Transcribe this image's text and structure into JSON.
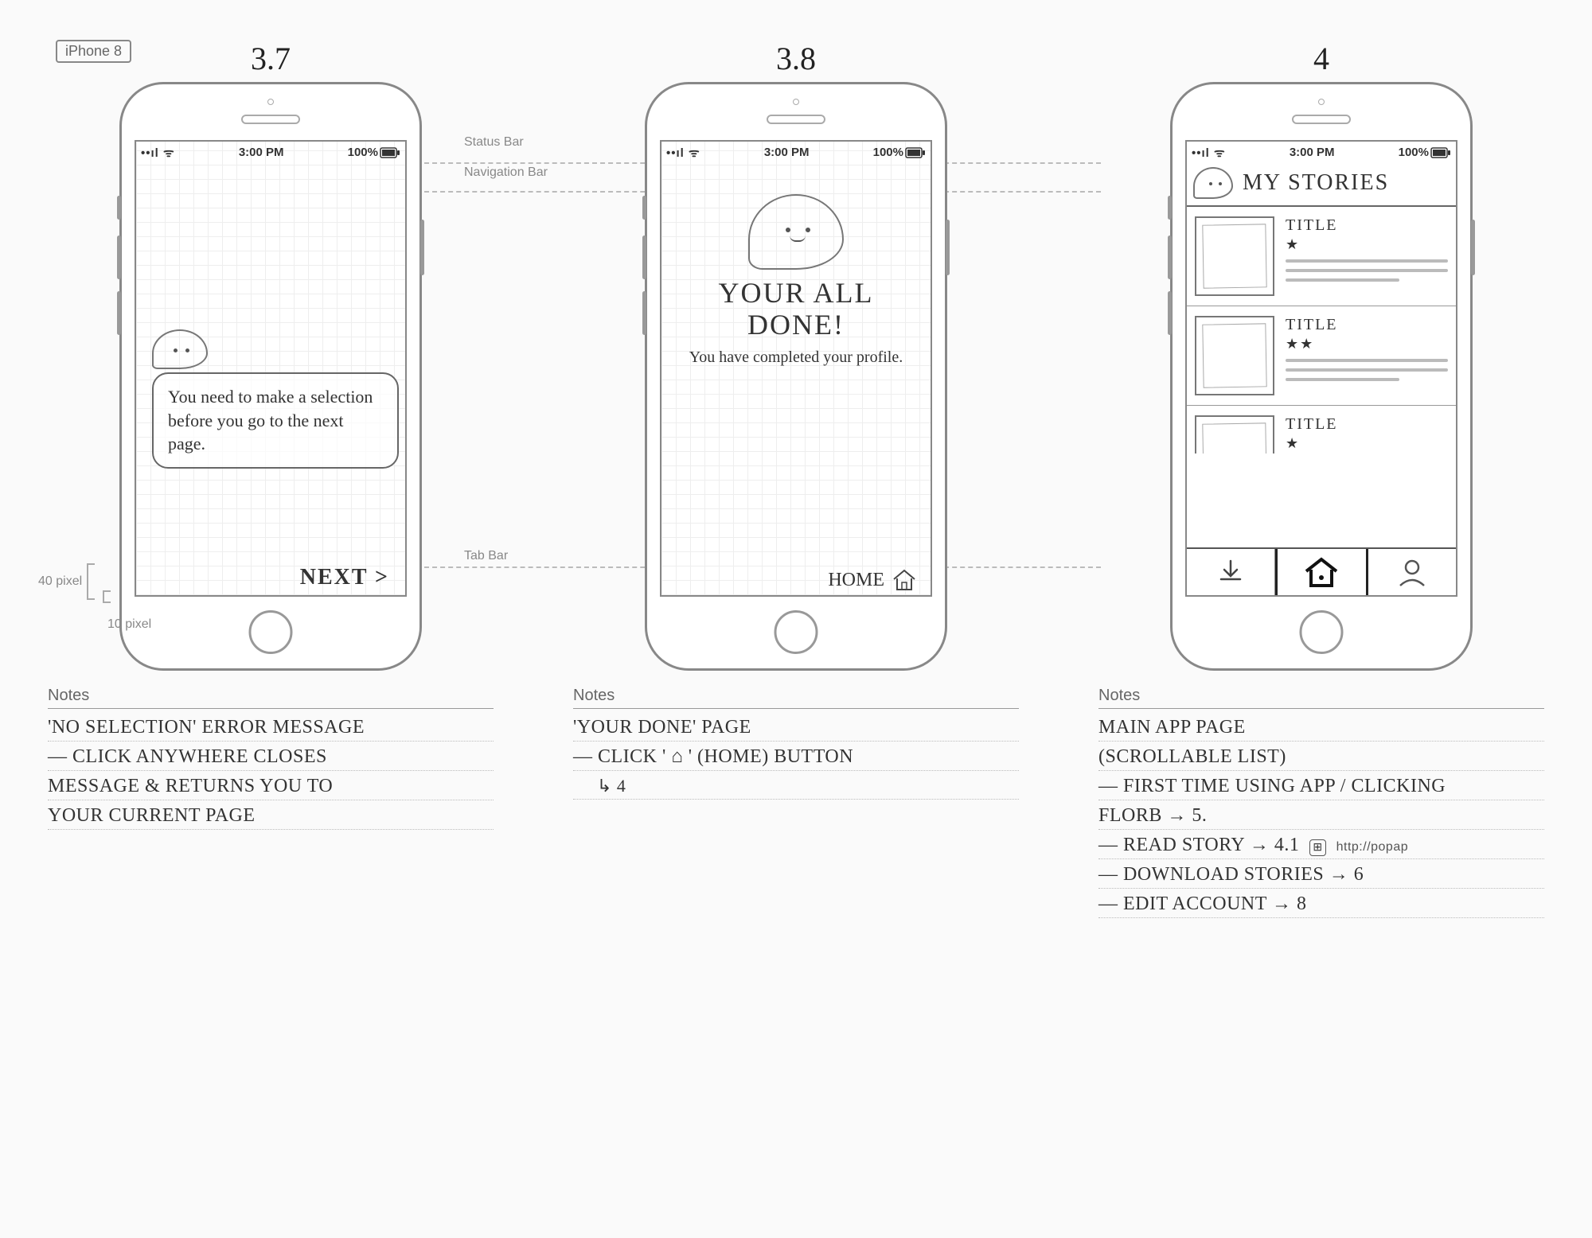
{
  "device_label": "iPhone 8",
  "guide_labels": {
    "status_bar": "Status Bar",
    "nav_bar": "Navigation Bar",
    "tab_bar": "Tab Bar",
    "px40": "40 pixel",
    "px10": "10 pixel"
  },
  "status_bar": {
    "carrier": "••ıl ᯤ",
    "time": "3:00 PM",
    "battery": "100%"
  },
  "screens": [
    {
      "number": "3.7",
      "message": "You need to make a selection before you go to the next page.",
      "next_label": "NEXT >"
    },
    {
      "number": "3.8",
      "headline_l1": "YOUR ALL",
      "headline_l2": "DONE!",
      "subtext": "You have completed your profile.",
      "home_label": "HOME"
    },
    {
      "number": "4",
      "header": "MY STORIES",
      "stories": [
        {
          "title": "TITLE",
          "stars": "★"
        },
        {
          "title": "TITLE",
          "stars": "★★"
        },
        {
          "title": "TITLE",
          "stars": "★"
        }
      ]
    }
  ],
  "notes_heading": "Notes",
  "notes": {
    "a": [
      "'NO SELECTION' ERROR MESSAGE",
      "— CLICK ANYWHERE CLOSES",
      "MESSAGE & RETURNS YOU TO",
      "YOUR CURRENT PAGE"
    ],
    "b": [
      "'YOUR DONE' PAGE",
      "— CLICK ' ⌂ ' (HOME) BUTTON",
      "↳ 4"
    ],
    "c": [
      "MAIN APP PAGE",
      "(SCROLLABLE LIST)",
      "— FIRST TIME USING APP / CLICKING",
      "FLORB → 5.",
      "— READ STORY → 4.1",
      "— DOWNLOAD STORIES → 6",
      "— EDIT ACCOUNT → 8"
    ],
    "c_url": "http://popap"
  }
}
